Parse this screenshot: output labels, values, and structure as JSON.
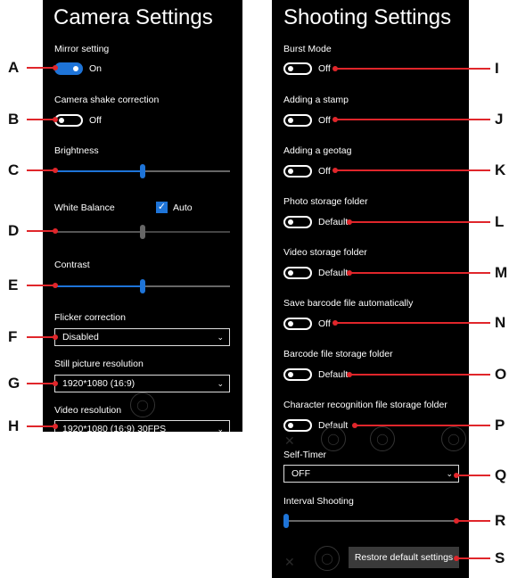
{
  "camera": {
    "title": "Camera Settings",
    "mirror": {
      "label": "Mirror setting",
      "value": "On"
    },
    "shake": {
      "label": "Camera shake correction",
      "value": "Off"
    },
    "brightness": {
      "label": "Brightness",
      "level": 0.5
    },
    "white_balance": {
      "label": "White Balance",
      "auto_label": "Auto",
      "auto_checked": true,
      "level": 0.5
    },
    "contrast": {
      "label": "Contrast",
      "level": 0.5
    },
    "flicker": {
      "label": "Flicker correction",
      "value": "Disabled"
    },
    "still_res": {
      "label": "Still picture resolution",
      "value": "1920*1080 (16:9)"
    },
    "video_res": {
      "label": "Video resolution",
      "value": "1920*1080 (16:9) 30FPS"
    }
  },
  "shooting": {
    "title": "Shooting Settings",
    "burst": {
      "label": "Burst Mode",
      "value": "Off"
    },
    "stamp": {
      "label": "Adding a stamp",
      "value": "Off"
    },
    "geotag": {
      "label": "Adding a geotag",
      "value": "Off"
    },
    "photo_folder": {
      "label": "Photo storage folder",
      "value": "Default"
    },
    "video_folder": {
      "label": "Video storage folder",
      "value": "Default"
    },
    "barcode_auto": {
      "label": "Save barcode file automatically",
      "value": "Off"
    },
    "barcode_folder": {
      "label": "Barcode file storage folder",
      "value": "Default"
    },
    "char_folder": {
      "label": "Character recognition file storage folder",
      "value": "Default"
    },
    "self_timer": {
      "label": "Self-Timer",
      "value": "OFF"
    },
    "interval": {
      "label": "Interval Shooting",
      "level": 0.0
    },
    "restore_label": "Restore default settings"
  },
  "callouts": [
    "A",
    "B",
    "C",
    "D",
    "E",
    "F",
    "G",
    "H",
    "I",
    "J",
    "K",
    "L",
    "M",
    "N",
    "O",
    "P",
    "Q",
    "R",
    "S"
  ],
  "colors": {
    "accent": "#1e74d8",
    "callout": "#e0262b",
    "panel": "#000000"
  }
}
